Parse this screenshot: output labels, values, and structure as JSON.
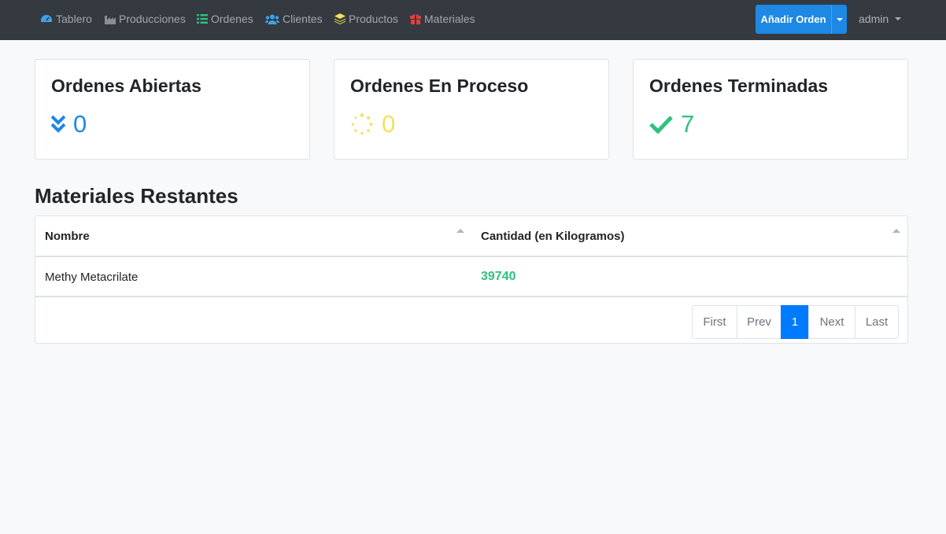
{
  "nav": {
    "items": [
      {
        "label": "Tablero",
        "icon": "tachometer-icon",
        "color": "#3ea3e8"
      },
      {
        "label": "Producciones",
        "icon": "industry-icon",
        "color": "#8a8f94"
      },
      {
        "label": "Ordenes",
        "icon": "list-icon",
        "color": "#2ec27e"
      },
      {
        "label": "Clientes",
        "icon": "users-icon",
        "color": "#3ea3e8"
      },
      {
        "label": "Productos",
        "icon": "layers-icon",
        "color": "#f6e05e"
      },
      {
        "label": "Materiales",
        "icon": "gift-icon",
        "color": "#e53e3e"
      }
    ],
    "add_order_label": "Añadir Orden",
    "user_label": "admin"
  },
  "cards": [
    {
      "title": "Ordenes Abiertas",
      "value": "0",
      "icon": "double-chevron-down-icon",
      "color": "#1e88e5"
    },
    {
      "title": "Ordenes En Proceso",
      "value": "0",
      "icon": "spinner-icon",
      "color": "#f6e05e"
    },
    {
      "title": "Ordenes Terminadas",
      "value": "7",
      "icon": "check-icon",
      "color": "#2ec27e"
    }
  ],
  "materials": {
    "title": "Materiales Restantes",
    "columns": [
      "Nombre",
      "Cantidad (en Kilogramos)"
    ],
    "rows": [
      {
        "name": "Methy Metacrilate",
        "qty": "39740"
      }
    ],
    "qty_color": "#2ec27e"
  },
  "pagination": {
    "first": "First",
    "prev": "Prev",
    "current": "1",
    "next": "Next",
    "last": "Last"
  }
}
